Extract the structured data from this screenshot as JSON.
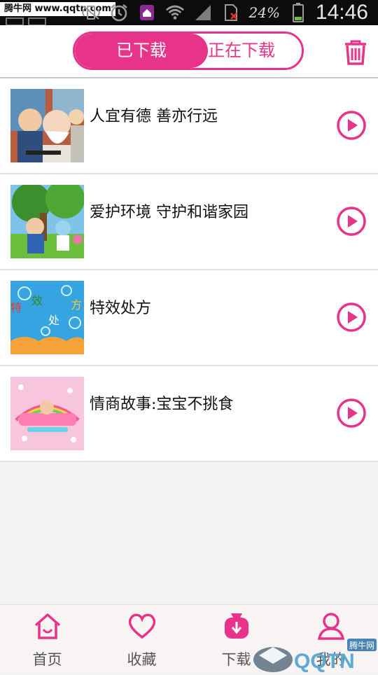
{
  "watermark_top": "腾牛网 www.qqtn.com",
  "status_bar": {
    "battery_percent": "24%",
    "time": "14:46"
  },
  "header": {
    "tab_downloaded": "已下载",
    "tab_downloading": "正在下载",
    "delete_icon": "trash-icon",
    "accent_color": "#e8338a"
  },
  "downloads": [
    {
      "title": "人宜有德 善亦行远",
      "thumb_text": "",
      "play_icon": "play-circle-icon"
    },
    {
      "title": "爱护环境 守护和谐家园",
      "thumb_text": "",
      "play_icon": "play-circle-icon"
    },
    {
      "title": "特效处方",
      "thumb_text": "特效处方",
      "play_icon": "play-circle-icon"
    },
    {
      "title": "情商故事:宝宝不挑食",
      "thumb_text": "",
      "play_icon": "play-circle-icon"
    }
  ],
  "bottom_nav": [
    {
      "label": "首页",
      "icon": "home-icon"
    },
    {
      "label": "收藏",
      "icon": "heart-icon"
    },
    {
      "label": "下载",
      "icon": "download-icon"
    },
    {
      "label": "我的",
      "icon": "user-icon"
    }
  ],
  "watermark_bottom": {
    "brand": "QQTN",
    "tag": "腾牛网"
  }
}
